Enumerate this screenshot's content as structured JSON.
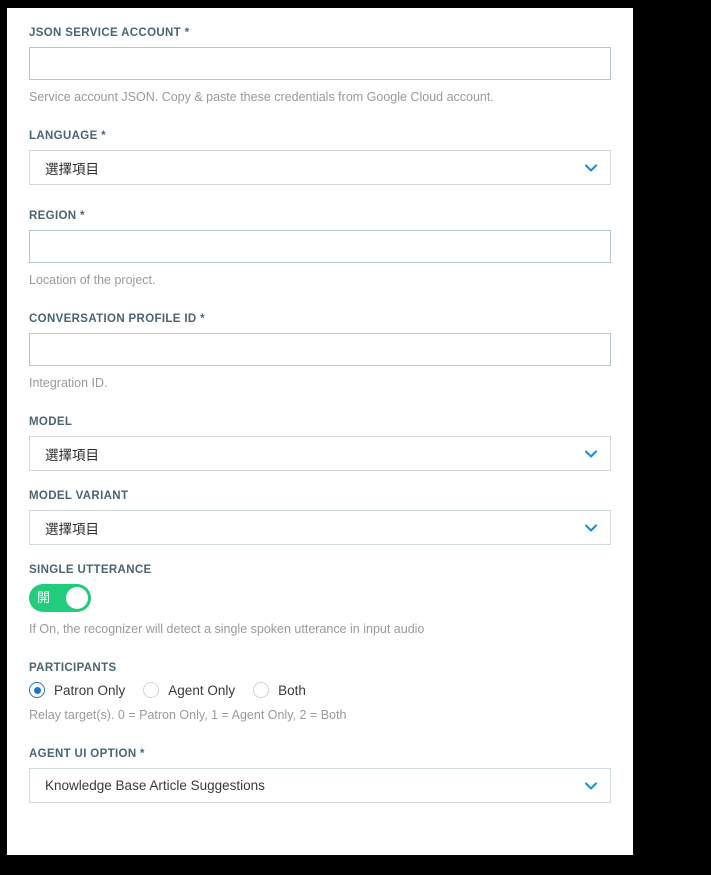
{
  "form": {
    "fields": [
      {
        "key": "json_service_account",
        "label": "JSON SERVICE ACCOUNT *",
        "type": "text",
        "value": "",
        "placeholder": "",
        "help": "Service account JSON. Copy & paste these credentials from Google Cloud account."
      },
      {
        "key": "language",
        "label": "LANGUAGE *",
        "type": "select",
        "value": "選擇項目",
        "help": ""
      },
      {
        "key": "region",
        "label": "REGION *",
        "type": "text",
        "value": "",
        "placeholder": "",
        "help": "Location of the project."
      },
      {
        "key": "conversation_profile_id",
        "label": "CONVERSATION PROFILE ID *",
        "type": "text",
        "value": "",
        "placeholder": "",
        "help": "Integration ID."
      },
      {
        "key": "model",
        "label": "MODEL",
        "type": "select",
        "value": "選擇項目",
        "help": ""
      },
      {
        "key": "model_variant",
        "label": "MODEL VARIANT",
        "type": "select",
        "value": "選擇項目",
        "help": ""
      },
      {
        "key": "single_utterance",
        "label": "SINGLE UTTERANCE",
        "type": "toggle",
        "toggle_state_label": "開",
        "toggle_on": true,
        "help": "If On, the recognizer will detect a single spoken utterance in input audio"
      },
      {
        "key": "participants",
        "label": "PARTICIPANTS",
        "type": "radio",
        "options": [
          "Patron Only",
          "Agent Only",
          "Both"
        ],
        "selected_index": 0,
        "help": "Relay target(s). 0 = Patron Only, 1 = Agent Only, 2 = Both"
      },
      {
        "key": "agent_ui_option",
        "label": "AGENT UI OPTION *",
        "type": "select",
        "value": "Knowledge Base Article Suggestions",
        "help": ""
      }
    ]
  },
  "icons": {
    "chevron_down": "chevron-down-icon"
  },
  "colors": {
    "label": "#4b6472",
    "input_border": "#b7c5cd",
    "select_border": "#cfd8dd",
    "help_text": "#9a9a9a",
    "chevron_blue": "#1a8fe0",
    "toggle_on_green": "#21cc7d",
    "radio_selected_blue": "#2472c8",
    "panel_background": "#ffffff",
    "page_background": "#000000"
  }
}
